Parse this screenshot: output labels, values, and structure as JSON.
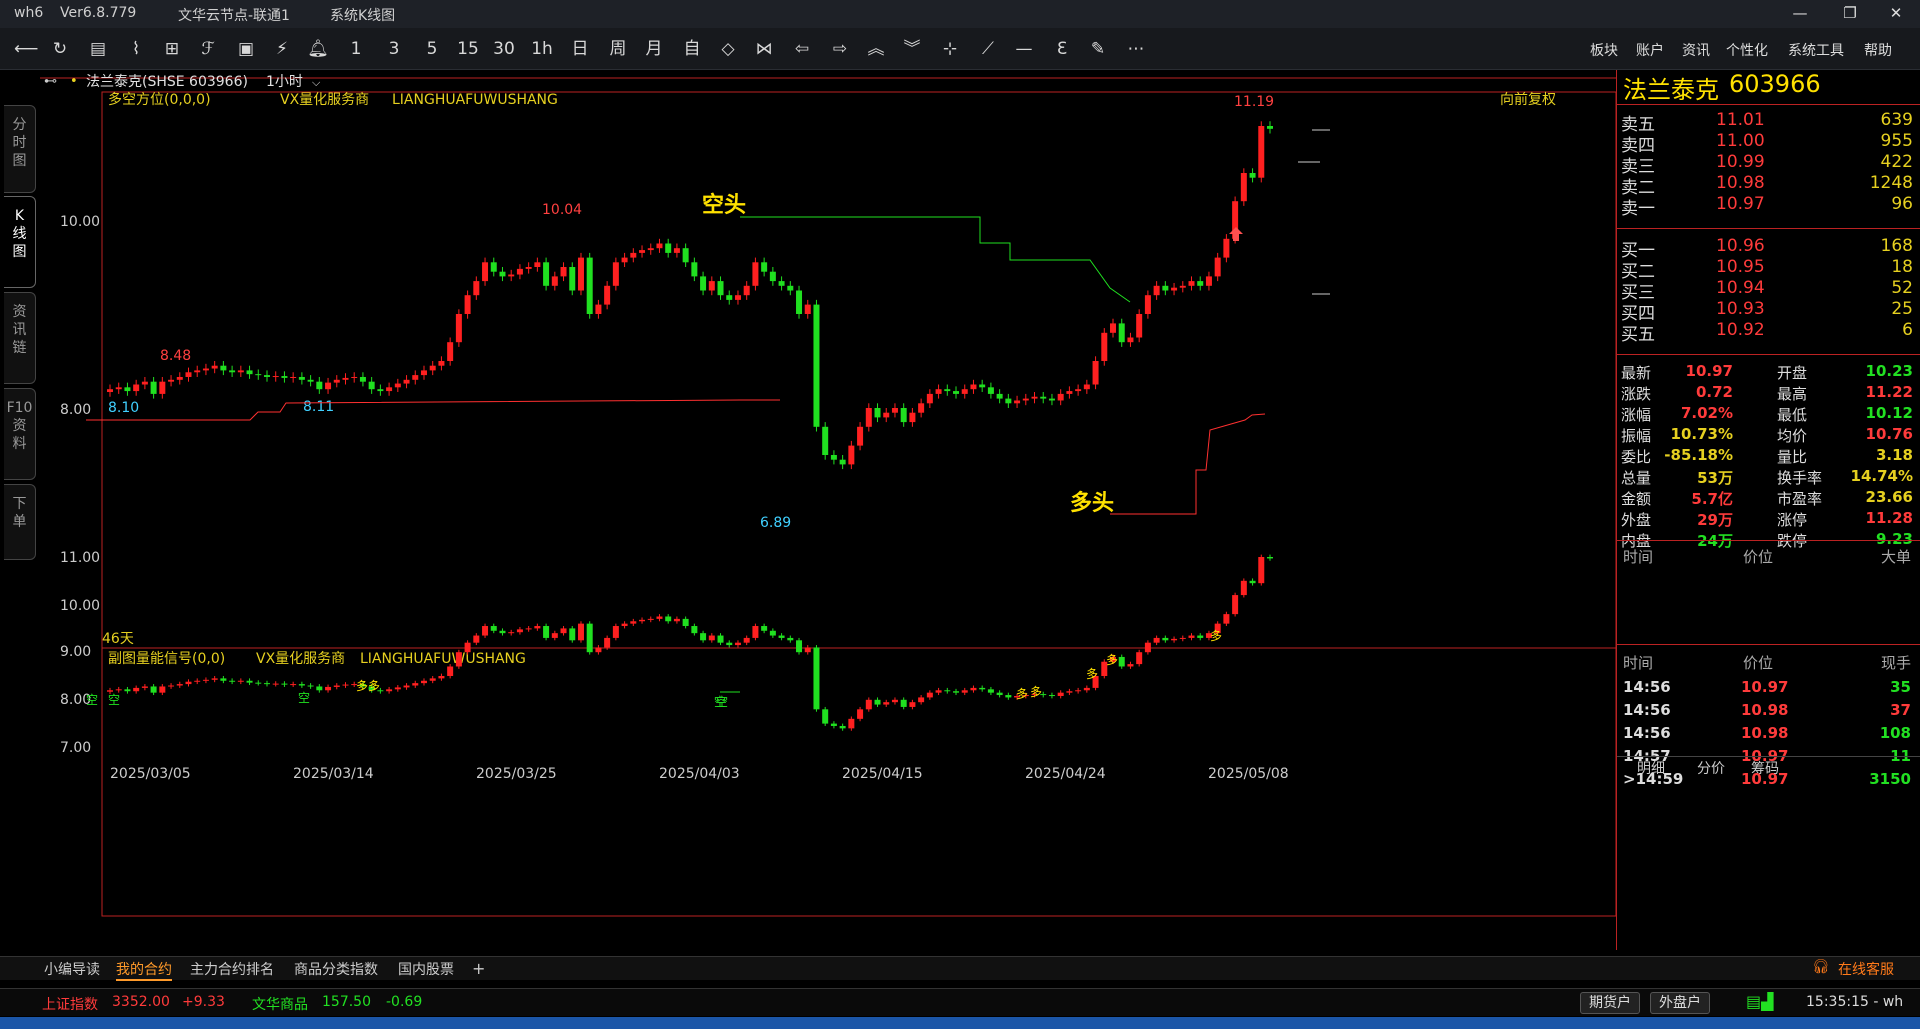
{
  "window": {
    "app": "wh6",
    "version": "Ver6.8.779",
    "server": "文华云节点-联通1",
    "view": "系统K线图"
  },
  "toolbar": {
    "period_buttons": [
      "1",
      "3",
      "5",
      "15",
      "30",
      "1h",
      "日",
      "周",
      "月",
      "自"
    ],
    "menus": [
      "板块",
      "账户",
      "资讯",
      "个性化",
      "系统工具",
      "帮助"
    ]
  },
  "left_tabs": [
    {
      "label": "分\n时\n图"
    },
    {
      "label": "K\n线\n图"
    },
    {
      "label": "资\n讯\n链"
    },
    {
      "label": "F10\n资\n料"
    },
    {
      "label": "下\n单"
    }
  ],
  "chart_header": {
    "symbol": "法兰泰克(SHSE 603966)",
    "period": "1小时",
    "adjust": "向前复权"
  },
  "main_indicator": {
    "name": "多空方位(0,0,0)",
    "vendor": "VX量化服务商",
    "code": "LIANGHUAFUWUSHANG",
    "days": "46天",
    "label_bear": "空头",
    "label_bull": "多头"
  },
  "sub_indicator": {
    "name": "副图量能信号(0,0)",
    "vendor": "VX量化服务商",
    "code": "LIANGHUAFUWUSHANG",
    "sig_bear": "空",
    "sig_bull": "多"
  },
  "chart_data": {
    "type": "candlestick",
    "dates": [
      "2025/03/05",
      "2025/03/14",
      "2025/03/25",
      "2025/04/03",
      "2025/04/15",
      "2025/04/24",
      "2025/05/08"
    ],
    "main_yticks": [
      "10.00",
      "8.00"
    ],
    "sub_yticks": [
      "11.00",
      "10.00",
      "9.00",
      "8.00",
      "7.00"
    ],
    "annotations": {
      "h1": "8.48",
      "l1": "8.10",
      "l2": "8.11",
      "h2": "10.04",
      "l3": "6.89",
      "h3": "11.19"
    },
    "closes": [
      8.2,
      8.22,
      8.18,
      8.25,
      8.28,
      8.15,
      8.28,
      8.3,
      8.33,
      8.38,
      8.4,
      8.42,
      8.45,
      8.4,
      8.38,
      8.4,
      8.36,
      8.35,
      8.33,
      8.34,
      8.32,
      8.33,
      8.3,
      8.28,
      8.2,
      8.27,
      8.3,
      8.32,
      8.33,
      8.28,
      8.2,
      8.18,
      8.22,
      8.26,
      8.3,
      8.35,
      8.4,
      8.45,
      8.5,
      8.7,
      9.0,
      9.2,
      9.35,
      9.55,
      9.45,
      9.4,
      9.42,
      9.48,
      9.5,
      9.55,
      9.3,
      9.4,
      9.5,
      9.25,
      9.6,
      9.0,
      9.1,
      9.3,
      9.55,
      9.6,
      9.65,
      9.68,
      9.7,
      9.75,
      9.65,
      9.7,
      9.55,
      9.4,
      9.25,
      9.35,
      9.2,
      9.15,
      9.2,
      9.3,
      9.55,
      9.45,
      9.35,
      9.3,
      9.25,
      9.0,
      9.1,
      7.8,
      7.5,
      7.45,
      7.4,
      7.6,
      7.8,
      8.0,
      7.9,
      7.95,
      8.0,
      7.85,
      7.95,
      8.05,
      8.15,
      8.2,
      8.18,
      8.15,
      8.2,
      8.25,
      8.22,
      8.15,
      8.1,
      8.05,
      8.08,
      8.1,
      8.12,
      8.1,
      8.08,
      8.15,
      8.18,
      8.2,
      8.25,
      8.5,
      8.8,
      8.9,
      8.7,
      8.75,
      9.0,
      9.2,
      9.3,
      9.25,
      9.28,
      9.3,
      9.35,
      9.3,
      9.4,
      9.6,
      9.8,
      10.2,
      10.5,
      10.45,
      11.0,
      10.97
    ],
    "signals": [
      "空@0",
      "空@6",
      "空@52",
      "多@68",
      "多@70",
      "空@149",
      "空@155",
      "多@222",
      "多@225",
      "多@242",
      "多@246",
      "多@263"
    ]
  },
  "quote": {
    "name": "法兰泰克",
    "code": "603966",
    "asks": [
      {
        "label": "卖五",
        "price": "11.01",
        "vol": "639"
      },
      {
        "label": "卖四",
        "price": "11.00",
        "vol": "955"
      },
      {
        "label": "卖三",
        "price": "10.99",
        "vol": "422"
      },
      {
        "label": "卖二",
        "price": "10.98",
        "vol": "1248"
      },
      {
        "label": "卖一",
        "price": "10.97",
        "vol": "96"
      }
    ],
    "bids": [
      {
        "label": "买一",
        "price": "10.96",
        "vol": "168"
      },
      {
        "label": "买二",
        "price": "10.95",
        "vol": "18"
      },
      {
        "label": "买三",
        "price": "10.94",
        "vol": "52"
      },
      {
        "label": "买四",
        "price": "10.93",
        "vol": "25"
      },
      {
        "label": "买五",
        "price": "10.92",
        "vol": "6"
      }
    ],
    "stats": [
      {
        "l": "最新",
        "v": "10.97",
        "c": "red",
        "l2": "开盘",
        "v2": "10.23",
        "c2": "green"
      },
      {
        "l": "涨跌",
        "v": "0.72",
        "c": "red",
        "l2": "最高",
        "v2": "11.22",
        "c2": "red"
      },
      {
        "l": "涨幅",
        "v": "7.02%",
        "c": "red",
        "l2": "最低",
        "v2": "10.12",
        "c2": "green"
      },
      {
        "l": "振幅",
        "v": "10.73%",
        "c": "yellow",
        "l2": "均价",
        "v2": "10.76",
        "c2": "red"
      },
      {
        "l": "委比",
        "v": "-85.18%",
        "c": "yellow",
        "l2": "量比",
        "v2": "3.18",
        "c2": "yellow"
      },
      {
        "l": "总量",
        "v": "53万",
        "c": "yellow",
        "l2": "换手率",
        "v2": "14.74%",
        "c2": "yellow"
      },
      {
        "l": "金额",
        "v": "5.7亿",
        "c": "red",
        "l2": "市盈率",
        "v2": "23.66",
        "c2": "yellow"
      },
      {
        "l": "外盘",
        "v": "29万",
        "c": "red",
        "l2": "涨停",
        "v2": "11.28",
        "c2": "red"
      },
      {
        "l": "内盘",
        "v": "24万",
        "c": "green",
        "l2": "跌停",
        "v2": "9.23",
        "c2": "green"
      }
    ],
    "head1": {
      "a": "时间",
      "b": "价位",
      "c": "大单"
    },
    "head2": {
      "a": "时间",
      "b": "价位",
      "c": "现手"
    },
    "ticks": [
      {
        "t": "14:56",
        "p": "10.97",
        "v": "35",
        "vc": "green"
      },
      {
        "t": "14:56",
        "p": "10.98",
        "v": "37",
        "vc": "red"
      },
      {
        "t": "14:56",
        "p": "10.98",
        "v": "108",
        "vc": "green"
      },
      {
        "t": "14:57",
        "p": "10.97",
        "v": "11",
        "vc": "green"
      },
      {
        "t": ">14:59",
        "p": "10.97",
        "v": "3150",
        "vc": "green"
      }
    ],
    "tabs": [
      "明细",
      "分价",
      "筹码"
    ]
  },
  "bottom_tabs": [
    "小编导读",
    "我的合约",
    "主力合约排名",
    "商品分类指数",
    "国内股票",
    "+"
  ],
  "service": "在线客服",
  "status": {
    "i1_name": "上证指数",
    "i1_val": "3352.00",
    "i1_chg": "+9.33",
    "i2_name": "文华商品",
    "i2_val": "157.50",
    "i2_chg": "-0.69",
    "btn1": "期货户",
    "btn2": "外盘户",
    "clock": "15:35:15 - wh"
  }
}
